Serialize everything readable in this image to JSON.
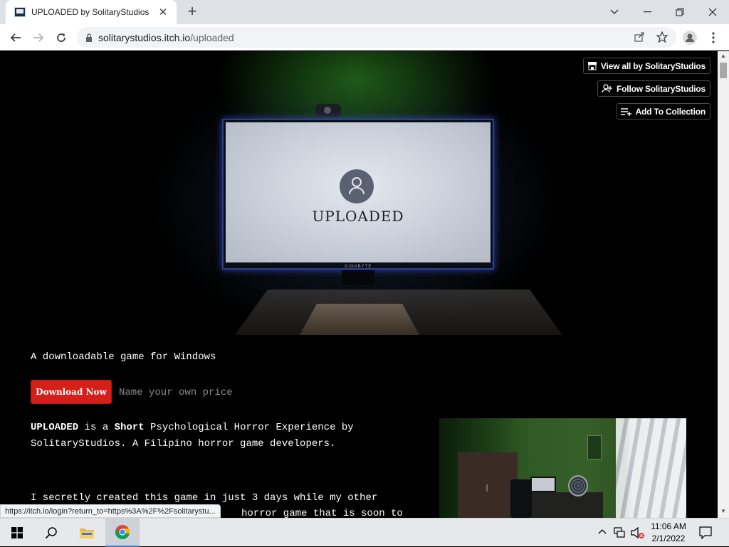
{
  "browser": {
    "tab_title": "UPLOADED by SolitaryStudios",
    "url_host": "solitarystudios.itch.io",
    "url_path": "/uploaded",
    "status_link": "https://itch.io/login?return_to=https%3A%2F%2Fsolitarystu..."
  },
  "hero": {
    "screen_title": "UPLOADED",
    "monitor_brand": "GIGABYTE"
  },
  "actions": {
    "view_all": "View all by SolitaryStudios",
    "follow": "Follow SolitaryStudios",
    "add_collection": "Add To Collection"
  },
  "game": {
    "tagline": "A downloadable game for Windows",
    "download_button": "Download Now",
    "price_label": "Name your own price",
    "desc_title": "UPLOADED",
    "desc_is": " is a ",
    "desc_short": "Short",
    "desc_rest": " Psychological Horror Experience by SolitaryStudios. A Filipino horror game developers.",
    "desc2_line1": "I secretly created this game in just 3 days while my other",
    "desc2_line2": "horror game that is soon to"
  },
  "taskbar": {
    "time": "11:06 AM",
    "date": "2/1/2022"
  },
  "colors": {
    "download_red": "#d5201a",
    "page_bg": "#000000",
    "accent_glow": "#2a3d8f"
  }
}
